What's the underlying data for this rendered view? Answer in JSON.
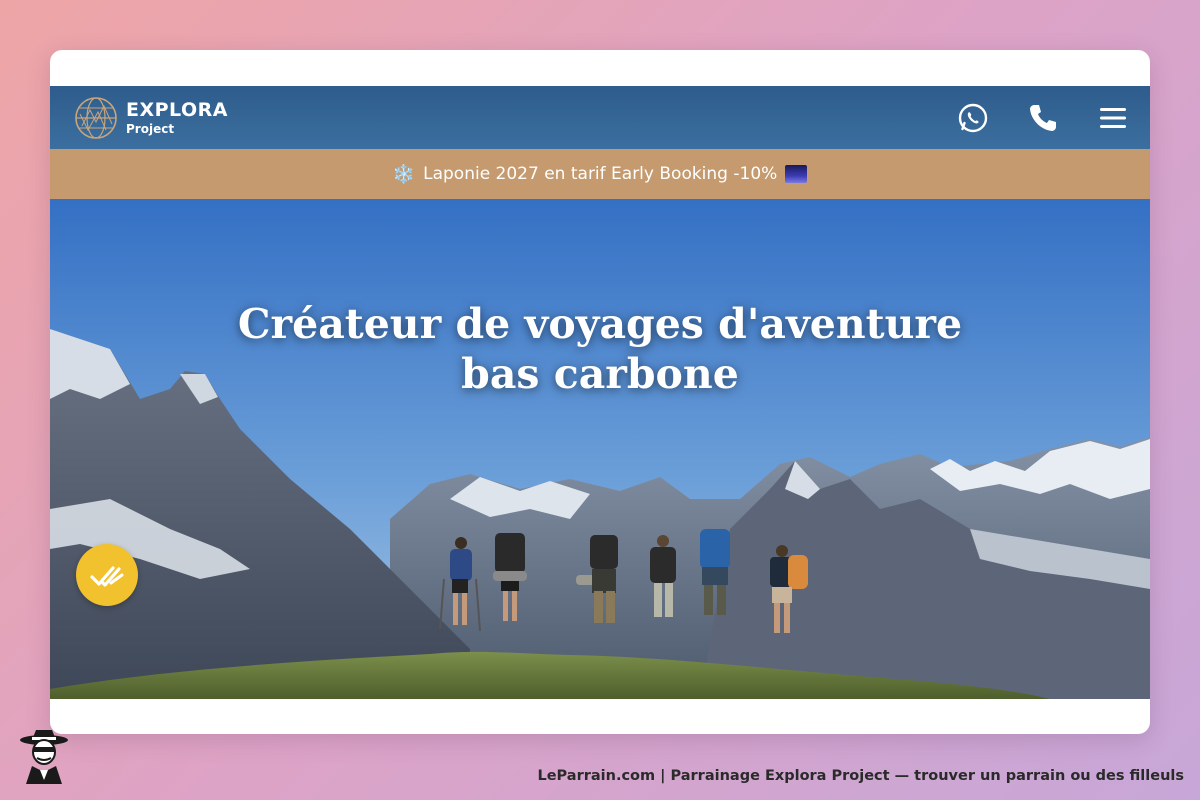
{
  "header": {
    "brand_name": "EXPLORA",
    "brand_sub": "Project",
    "icons": [
      "whatsapp-icon",
      "phone-icon",
      "hamburger-menu-icon"
    ]
  },
  "banner": {
    "emoji": "❄️",
    "text": "Laponie 2027 en tarif Early Booking -10%"
  },
  "hero": {
    "title_line1": "Créateur de voyages d'aventure",
    "title_line2": "bas carbone"
  },
  "badge": {
    "icon": "double-check-icon",
    "color": "#f2c12e"
  },
  "footer": {
    "caption": "LeParrain.com | Parrainage Explora Project — trouver un parrain ou des filleuls"
  },
  "colors": {
    "navbar": "#2e5c8c",
    "banner": "#c49a6e",
    "sky": "#3d78c9"
  }
}
